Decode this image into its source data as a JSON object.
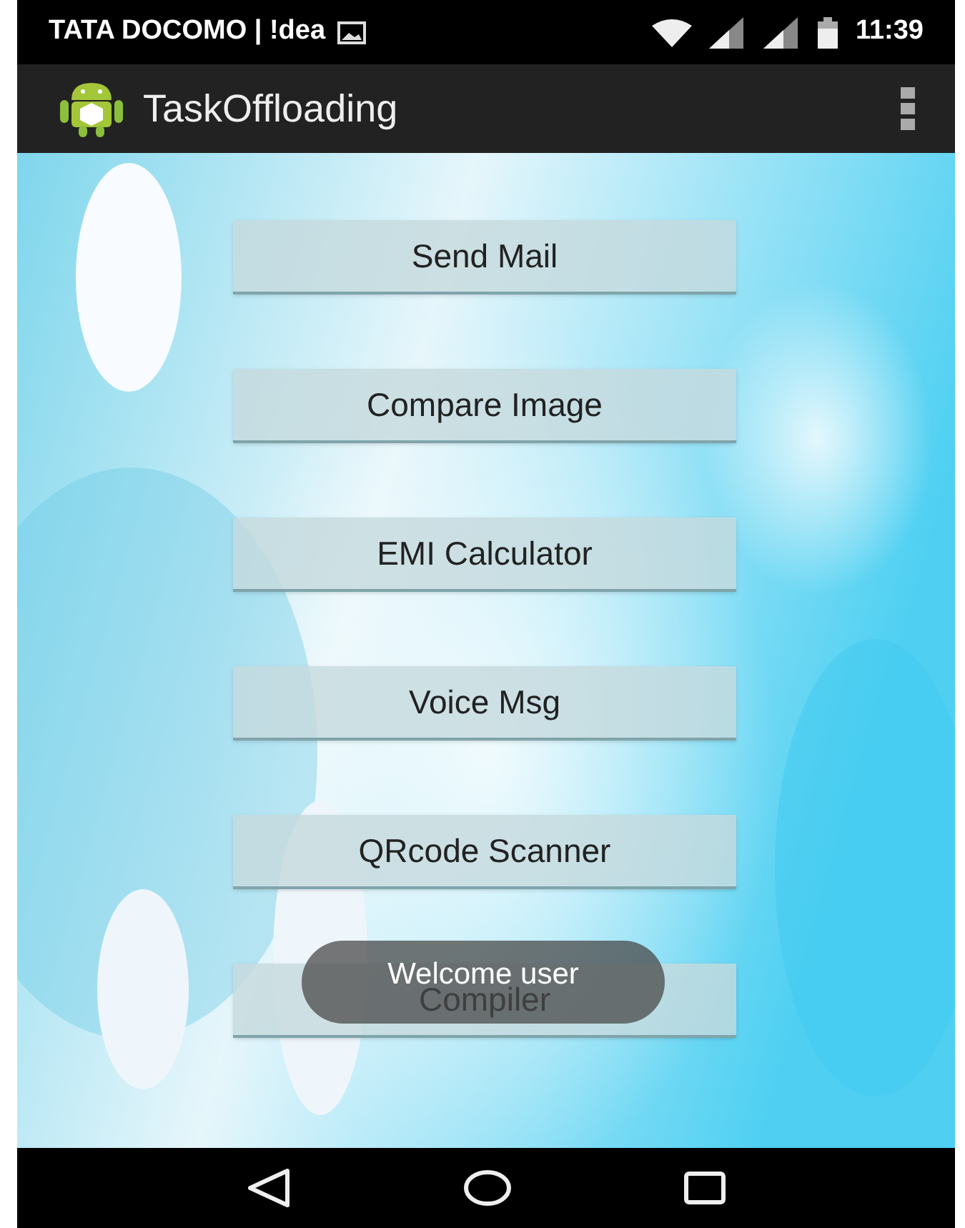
{
  "status_bar": {
    "carrier": "TATA DOCOMO | !dea",
    "time": "11:39"
  },
  "app_bar": {
    "title": "TaskOffloading"
  },
  "buttons": [
    {
      "label": "Send Mail"
    },
    {
      "label": "Compare Image"
    },
    {
      "label": "EMI Calculator"
    },
    {
      "label": "Voice Msg"
    },
    {
      "label": "QRcode Scanner"
    },
    {
      "label": "Compiler"
    }
  ],
  "toast": {
    "text": "Welcome user"
  }
}
